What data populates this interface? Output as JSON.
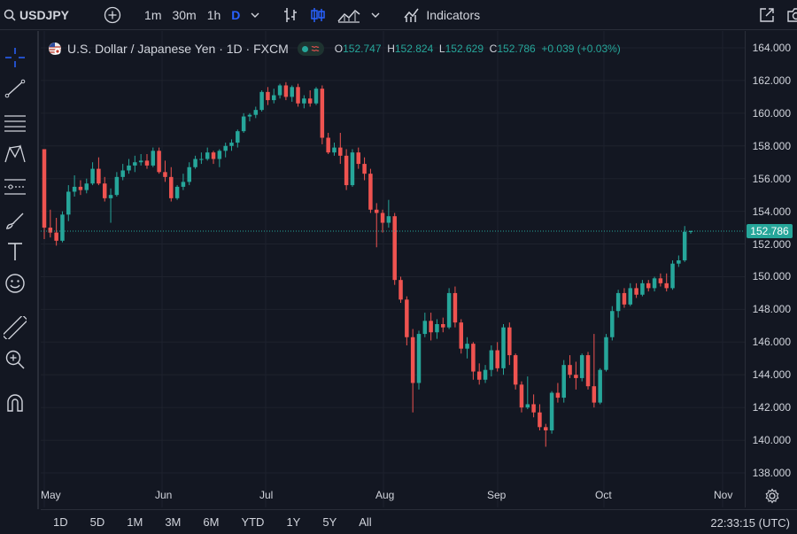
{
  "toolbar": {
    "symbol": "USDJPY",
    "intervals": [
      "1m",
      "30m",
      "1h",
      "D"
    ],
    "indicators_label": "Indicators"
  },
  "legend": {
    "title": "U.S. Dollar / Japanese Yen · 1D · FXCM",
    "o_label": "O",
    "o": "152.747",
    "h_label": "H",
    "h": "152.824",
    "l_label": "L",
    "l": "152.629",
    "c_label": "C",
    "c": "152.786",
    "change": "+0.039 (+0.03%)"
  },
  "price_tag": "152.786",
  "y_ticks": [
    "164.000",
    "162.000",
    "160.000",
    "158.000",
    "156.000",
    "154.000",
    "152.000",
    "150.000",
    "148.000",
    "146.000",
    "144.000",
    "142.000",
    "140.000",
    "138.000"
  ],
  "x_ticks": [
    "May",
    "Jun",
    "Jul",
    "Aug",
    "Sep",
    "Oct",
    "Nov"
  ],
  "ranges": [
    "1D",
    "5D",
    "1M",
    "3M",
    "6M",
    "YTD",
    "1Y",
    "5Y",
    "All"
  ],
  "clock": "22:33:15 (UTC)",
  "colors": {
    "up": "#26a69a",
    "down": "#ef5350",
    "bg": "#131722",
    "grid": "#1e222d"
  },
  "chart_data": {
    "type": "candlestick",
    "ylim": [
      137,
      165
    ],
    "last_close": 152.786,
    "candles": [
      [
        157.8,
        157.8,
        152.3,
        153.0
      ],
      [
        153.0,
        154.1,
        152.4,
        152.7
      ],
      [
        152.7,
        153.6,
        151.9,
        152.2
      ],
      [
        152.2,
        154.0,
        152.1,
        153.8
      ],
      [
        153.8,
        155.6,
        153.4,
        155.2
      ],
      [
        155.2,
        156.2,
        154.9,
        155.5
      ],
      [
        155.5,
        155.9,
        155.0,
        155.3
      ],
      [
        155.3,
        156.0,
        155.1,
        155.7
      ],
      [
        155.7,
        157.0,
        155.6,
        156.6
      ],
      [
        156.6,
        157.3,
        155.6,
        155.7
      ],
      [
        155.7,
        156.1,
        154.6,
        154.8
      ],
      [
        154.8,
        155.4,
        153.3,
        155.0
      ],
      [
        155.0,
        156.4,
        154.9,
        156.1
      ],
      [
        156.1,
        156.9,
        155.9,
        156.5
      ],
      [
        156.5,
        157.2,
        156.3,
        156.8
      ],
      [
        156.8,
        157.4,
        156.4,
        157.0
      ],
      [
        157.0,
        157.5,
        156.8,
        157.1
      ],
      [
        157.1,
        157.5,
        156.6,
        156.8
      ],
      [
        156.8,
        157.9,
        156.7,
        157.7
      ],
      [
        157.7,
        157.9,
        156.3,
        156.4
      ],
      [
        156.4,
        157.1,
        155.8,
        156.1
      ],
      [
        156.1,
        156.7,
        154.6,
        154.8
      ],
      [
        154.8,
        155.6,
        154.7,
        155.5
      ],
      [
        155.5,
        156.3,
        155.3,
        155.8
      ],
      [
        155.8,
        157.0,
        155.6,
        156.7
      ],
      [
        156.7,
        157.4,
        156.6,
        157.2
      ],
      [
        157.2,
        157.6,
        156.9,
        157.2
      ],
      [
        157.2,
        157.9,
        157.1,
        157.6
      ],
      [
        157.6,
        157.7,
        156.9,
        157.2
      ],
      [
        157.2,
        157.8,
        156.7,
        157.7
      ],
      [
        157.7,
        158.2,
        157.3,
        158.0
      ],
      [
        158.0,
        158.4,
        157.7,
        158.2
      ],
      [
        158.2,
        159.0,
        157.9,
        158.9
      ],
      [
        158.9,
        160.0,
        158.8,
        159.8
      ],
      [
        159.8,
        160.0,
        159.5,
        159.9
      ],
      [
        159.9,
        160.4,
        159.7,
        160.2
      ],
      [
        160.2,
        161.4,
        160.1,
        161.3
      ],
      [
        161.3,
        161.6,
        160.5,
        160.8
      ],
      [
        160.8,
        161.5,
        160.6,
        161.1
      ],
      [
        161.1,
        161.8,
        160.9,
        161.7
      ],
      [
        161.7,
        161.9,
        160.8,
        161.0
      ],
      [
        161.0,
        161.7,
        160.7,
        161.6
      ],
      [
        161.6,
        161.8,
        160.4,
        160.6
      ],
      [
        160.6,
        161.1,
        160.3,
        160.9
      ],
      [
        160.9,
        161.4,
        160.4,
        160.6
      ],
      [
        160.6,
        161.6,
        160.5,
        161.5
      ],
      [
        161.5,
        161.7,
        158.1,
        158.5
      ],
      [
        158.5,
        158.8,
        157.5,
        157.6
      ],
      [
        157.6,
        158.2,
        157.4,
        157.9
      ],
      [
        157.9,
        158.8,
        156.9,
        157.4
      ],
      [
        157.4,
        157.8,
        155.3,
        155.6
      ],
      [
        155.6,
        157.8,
        155.5,
        157.6
      ],
      [
        157.6,
        157.9,
        156.6,
        156.9
      ],
      [
        156.9,
        157.3,
        155.9,
        156.3
      ],
      [
        156.3,
        156.6,
        153.9,
        154.1
      ],
      [
        154.1,
        154.5,
        151.8,
        153.9
      ],
      [
        153.9,
        154.1,
        152.7,
        153.3
      ],
      [
        153.3,
        154.7,
        153.0,
        153.7
      ],
      [
        153.7,
        153.9,
        149.5,
        149.8
      ],
      [
        149.8,
        150.0,
        148.4,
        148.6
      ],
      [
        148.6,
        148.8,
        145.8,
        146.3
      ],
      [
        146.3,
        146.8,
        141.7,
        143.5
      ],
      [
        143.5,
        146.7,
        143.1,
        146.5
      ],
      [
        146.5,
        147.8,
        146.3,
        147.3
      ],
      [
        147.3,
        147.8,
        146.1,
        146.6
      ],
      [
        146.6,
        147.4,
        146.2,
        147.1
      ],
      [
        147.1,
        147.5,
        146.6,
        146.9
      ],
      [
        146.9,
        149.3,
        146.8,
        149.0
      ],
      [
        149.0,
        149.4,
        146.9,
        147.2
      ],
      [
        147.2,
        147.4,
        145.3,
        145.6
      ],
      [
        145.6,
        146.3,
        145.0,
        145.9
      ],
      [
        145.9,
        146.0,
        143.7,
        144.2
      ],
      [
        144.2,
        144.7,
        143.4,
        143.7
      ],
      [
        143.7,
        144.6,
        143.5,
        144.3
      ],
      [
        144.3,
        145.8,
        143.9,
        145.5
      ],
      [
        145.5,
        146.0,
        144.2,
        144.4
      ],
      [
        144.4,
        147.1,
        144.0,
        146.9
      ],
      [
        146.9,
        147.2,
        144.6,
        145.2
      ],
      [
        145.2,
        145.3,
        143.1,
        143.4
      ],
      [
        143.4,
        143.6,
        141.7,
        142.0
      ],
      [
        142.0,
        143.9,
        141.9,
        142.2
      ],
      [
        142.2,
        142.8,
        141.4,
        141.7
      ],
      [
        141.7,
        142.2,
        140.6,
        140.8
      ],
      [
        140.8,
        141.0,
        139.6,
        140.6
      ],
      [
        140.6,
        143.0,
        140.4,
        142.9
      ],
      [
        142.9,
        143.5,
        142.3,
        142.6
      ],
      [
        142.6,
        144.9,
        142.3,
        144.6
      ],
      [
        144.6,
        145.2,
        143.8,
        144.0
      ],
      [
        144.0,
        144.8,
        143.1,
        143.8
      ],
      [
        143.8,
        145.3,
        143.6,
        145.2
      ],
      [
        145.2,
        145.4,
        143.1,
        143.3
      ],
      [
        143.3,
        146.5,
        142.0,
        142.3
      ],
      [
        142.3,
        144.4,
        142.2,
        144.3
      ],
      [
        144.3,
        146.5,
        144.2,
        146.3
      ],
      [
        146.3,
        148.2,
        146.1,
        147.9
      ],
      [
        147.9,
        149.2,
        147.5,
        149.0
      ],
      [
        149.0,
        149.3,
        148.1,
        148.3
      ],
      [
        148.3,
        149.6,
        148.2,
        149.3
      ],
      [
        149.3,
        149.6,
        148.7,
        148.9
      ],
      [
        148.9,
        149.8,
        148.8,
        149.6
      ],
      [
        149.6,
        149.8,
        149.1,
        149.3
      ],
      [
        149.3,
        150.0,
        149.1,
        149.9
      ],
      [
        149.9,
        150.2,
        149.4,
        149.6
      ],
      [
        149.6,
        150.2,
        149.1,
        149.3
      ],
      [
        149.3,
        151.0,
        149.2,
        150.8
      ],
      [
        150.8,
        151.3,
        150.6,
        151.0
      ],
      [
        151.0,
        153.1,
        150.9,
        152.747
      ],
      [
        152.747,
        152.824,
        152.629,
        152.786
      ]
    ]
  }
}
